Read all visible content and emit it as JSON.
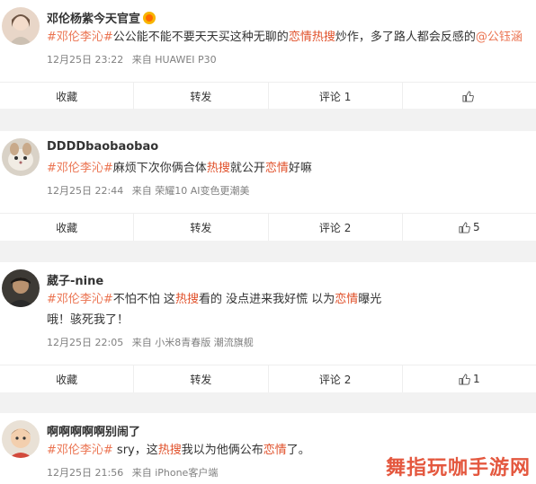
{
  "comments": [
    {
      "user": "邓伦杨紫今天官宣",
      "badge": "vip-badge-icon",
      "segments": [
        {
          "t": "#邓伦李沁#",
          "c": "topic"
        },
        {
          "t": "公公能不能不要天天买这种无聊的",
          "c": ""
        },
        {
          "t": "恋情",
          "c": "hot"
        },
        {
          "t": "热搜",
          "c": "hot"
        },
        {
          "t": "炒作，多了路人都会反感的",
          "c": ""
        },
        {
          "t": "@公钰涵",
          "c": "mention"
        }
      ],
      "text2": "",
      "date": "12月25日 23:22",
      "source": "来自 HUAWEI P30",
      "actions": {
        "collect": "收藏",
        "repost": "转发",
        "comment": "评论 1",
        "like": ""
      }
    },
    {
      "user": "DDDDbaobaobao",
      "segments": [
        {
          "t": "#邓伦李沁#",
          "c": "topic"
        },
        {
          "t": "麻烦下次你俩合体",
          "c": ""
        },
        {
          "t": "热搜",
          "c": "hot"
        },
        {
          "t": "就公开",
          "c": ""
        },
        {
          "t": "恋情",
          "c": "hot"
        },
        {
          "t": "好嘛",
          "c": ""
        }
      ],
      "text2": "",
      "date": "12月25日 22:44",
      "source": "来自 荣耀10 AI变色更潮美",
      "actions": {
        "collect": "收藏",
        "repost": "转发",
        "comment": "评论 2",
        "like": "5"
      }
    },
    {
      "user": "葳子-nine",
      "segments": [
        {
          "t": "#邓伦李沁#",
          "c": "topic"
        },
        {
          "t": "不怕不怕 这",
          "c": ""
        },
        {
          "t": "热搜",
          "c": "hot"
        },
        {
          "t": "看的 没点进来我好慌 以为",
          "c": ""
        },
        {
          "t": "恋情",
          "c": "hot"
        },
        {
          "t": "曝光",
          "c": ""
        }
      ],
      "text2": "哦！骇死我了！",
      "date": "12月25日 22:05",
      "source": "来自 小米8青春版 潮流旗舰",
      "actions": {
        "collect": "收藏",
        "repost": "转发",
        "comment": "评论 2",
        "like": "1"
      }
    },
    {
      "user": "啊啊啊啊啊别闹了",
      "segments": [
        {
          "t": "#邓伦李沁#",
          "c": "topic"
        },
        {
          "t": " sry，这",
          "c": ""
        },
        {
          "t": "热搜",
          "c": "hot"
        },
        {
          "t": "我以为他俩公布",
          "c": ""
        },
        {
          "t": "恋情",
          "c": "hot"
        },
        {
          "t": "了。",
          "c": ""
        }
      ],
      "text2": "",
      "date": "12月25日 21:56",
      "source": "来自 iPhone客户端",
      "actions": null
    }
  ],
  "watermark": "舞指玩咖手游网",
  "colors": {
    "topic": "#eb7350",
    "hot": "#e0502a",
    "meta": "#808080",
    "background": "#f2f2f2"
  }
}
